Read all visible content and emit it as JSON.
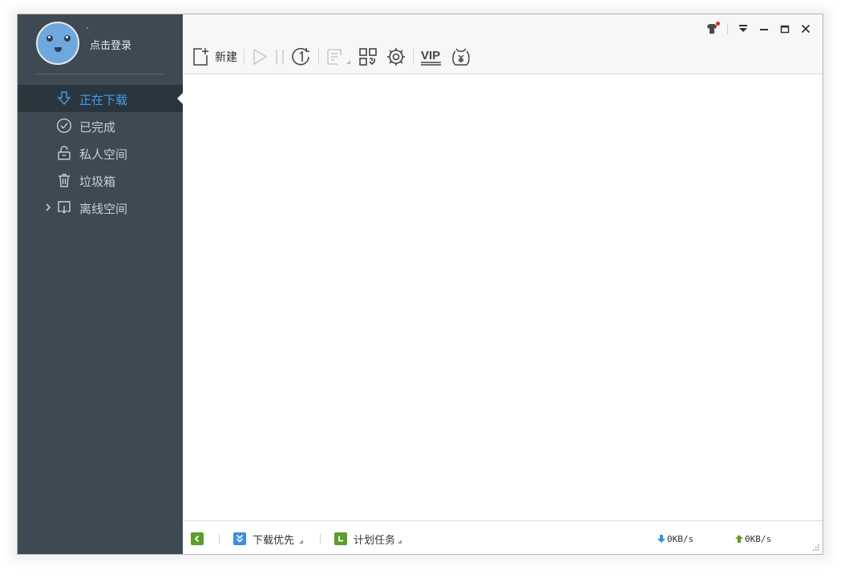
{
  "sidebar": {
    "login_label": "点击登录",
    "items": [
      {
        "label": "正在下载",
        "icon": "download-arrow-icon",
        "active": true
      },
      {
        "label": "已完成",
        "icon": "check-circle-icon"
      },
      {
        "label": "私人空间",
        "icon": "unlock-icon"
      },
      {
        "label": "垃圾箱",
        "icon": "trash-icon"
      },
      {
        "label": "离线空间",
        "icon": "cloud-download-icon",
        "expandable": true
      }
    ]
  },
  "toolbar": {
    "new_label": "新建",
    "icons": [
      "new-task-icon",
      "start-icon",
      "pause-icon",
      "speed-limit-icon",
      "open-folder-icon",
      "qr-code-icon",
      "settings-icon",
      "vip-icon",
      "money-icon"
    ],
    "vip_text": "VIP"
  },
  "window_controls": [
    "skin-icon",
    "menu-icon",
    "minimize-icon",
    "maximize-icon",
    "close-icon"
  ],
  "statusbar": {
    "mode_label": "下载优先",
    "schedule_label": "计划任务",
    "download_speed": "0KB/s",
    "upload_speed": "0KB/s"
  },
  "colors": {
    "sidebar_bg": "#3d4a53",
    "active_item_bg": "#2b353d",
    "accent_blue": "#3d9ff2",
    "green": "#5a9e2b"
  }
}
